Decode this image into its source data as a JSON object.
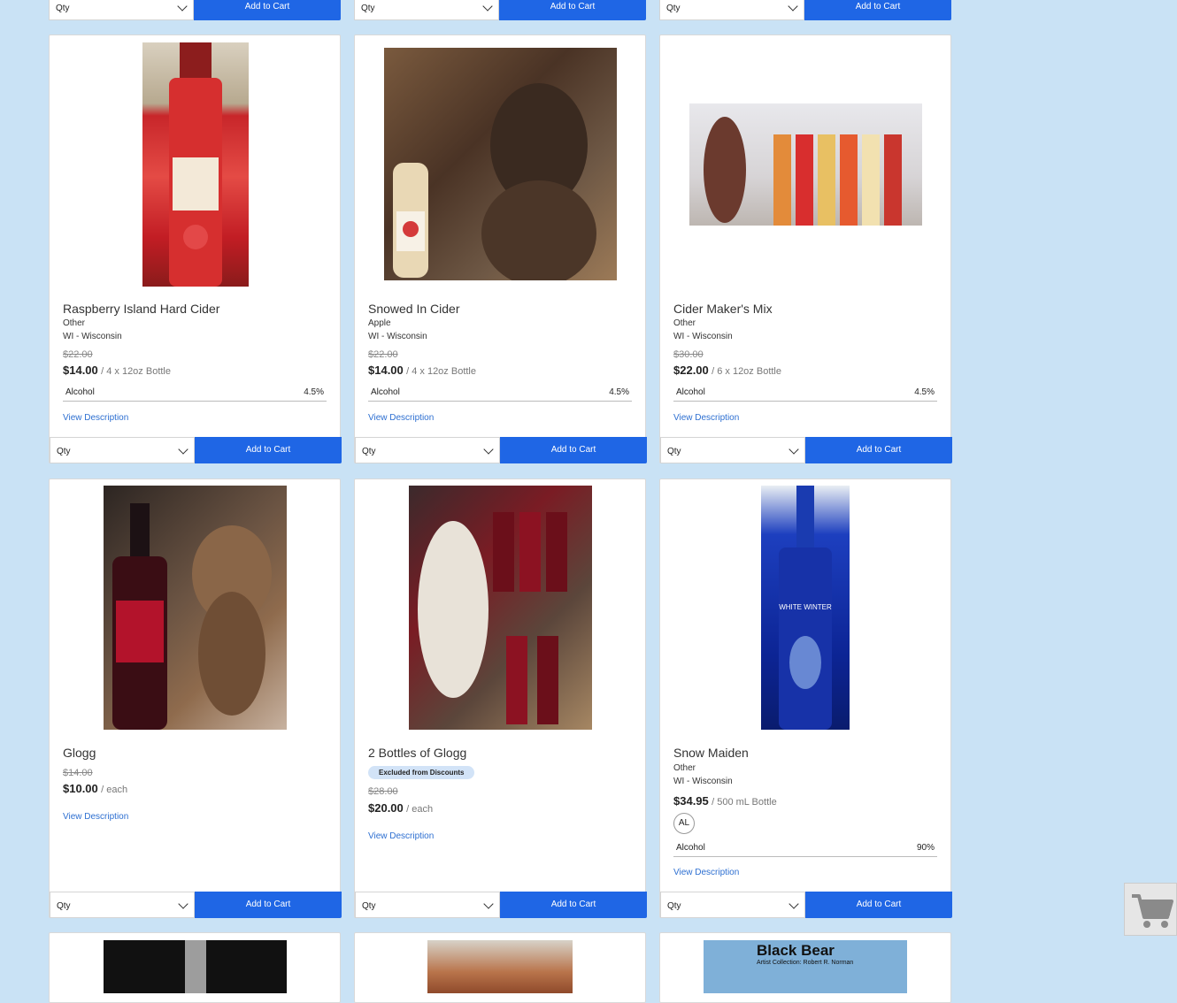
{
  "common": {
    "qty_label": "Qty",
    "add_to_cart_label": "Add to Cart",
    "view_description": "View Description",
    "alcohol_label": "Alcohol"
  },
  "top_row_bars": [
    {},
    {},
    {}
  ],
  "products": [
    {
      "name": "Raspberry Island Hard Cider",
      "type": "Other",
      "region": "WI - Wisconsin",
      "old_price": "$22.00",
      "price": "$14.00",
      "unit": "/ 4 x 12oz Bottle",
      "alcohol": "4.5%"
    },
    {
      "name": "Snowed In Cider",
      "type": "Apple",
      "region": "WI - Wisconsin",
      "old_price": "$22.00",
      "price": "$14.00",
      "unit": "/ 4 x 12oz Bottle",
      "alcohol": "4.5%"
    },
    {
      "name": "Cider Maker's Mix",
      "type": "Other",
      "region": "WI - Wisconsin",
      "old_price": "$30.00",
      "price": "$22.00",
      "unit": "/ 6 x 12oz Bottle",
      "alcohol": "4.5%"
    },
    {
      "name": "Glogg",
      "old_price": "$14.00",
      "price": "$10.00",
      "unit": "/ each"
    },
    {
      "name": "2 Bottles of Glogg",
      "badge": "Excluded from Discounts",
      "old_price": "$28.00",
      "price": "$20.00",
      "unit": "/ each"
    },
    {
      "name": "Snow Maiden",
      "type": "Other",
      "region": "WI - Wisconsin",
      "price": "$34.95",
      "unit": "/ 500 mL Bottle",
      "tag": "AL",
      "alcohol": "90%"
    }
  ],
  "bottom_partial_images": [
    "Black Bear",
    "Artist Collection: Robert R. Norman"
  ],
  "colors": {
    "background": "#c9e2f5",
    "accent": "#1f66e5",
    "link": "#2d6fd1"
  },
  "floating_cart": {
    "icon": "shopping-cart-icon"
  }
}
